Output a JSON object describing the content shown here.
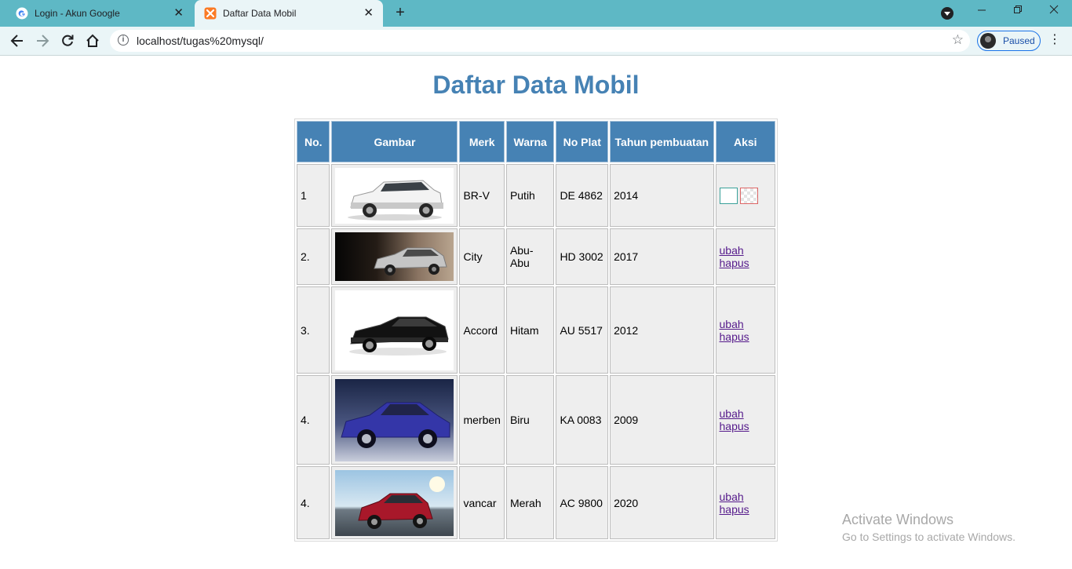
{
  "browser": {
    "tabs": [
      {
        "title": "Login - Akun Google",
        "active": false,
        "favicon": "google-icon"
      },
      {
        "title": "Daftar Data Mobil",
        "active": true,
        "favicon": "xampp-icon"
      }
    ],
    "close_glyph": "✕",
    "new_tab_glyph": "+",
    "address": "localhost/tugas%20mysql/",
    "profile_status": "Paused",
    "colors": {
      "tabstrip": "#5eb8c5",
      "toolbar": "#eaf5f7"
    }
  },
  "page": {
    "title": "Daftar Data Mobil",
    "columns": [
      "No.",
      "Gambar",
      "Merk",
      "Warna",
      "No Plat",
      "Tahun pembuatan",
      "Aksi"
    ],
    "rows": [
      {
        "no": "1",
        "merk": "BR-V",
        "warna": "Putih",
        "plat": "DE 4862",
        "tahun": "2014",
        "image": "white-suv",
        "aksi": "broken-images"
      },
      {
        "no": "2.",
        "merk": "City",
        "warna": "Abu-Abu",
        "plat": "HD 3002",
        "tahun": "2017",
        "image": "grey-sedan",
        "aksi": "links"
      },
      {
        "no": "3.",
        "merk": "Accord",
        "warna": "Hitam",
        "plat": "AU 5517",
        "tahun": "2012",
        "image": "black-sedan",
        "aksi": "links"
      },
      {
        "no": "4.",
        "merk": "merben",
        "warna": "Biru",
        "plat": "KA 0083",
        "tahun": "2009",
        "image": "blue-sedan",
        "aksi": "links"
      },
      {
        "no": "4.",
        "merk": "vancar",
        "warna": "Merah",
        "plat": "AC 9800",
        "tahun": "2020",
        "image": "red-crossover",
        "aksi": "links"
      }
    ],
    "edit_label": "ubah",
    "delete_label": "hapus",
    "colors": {
      "header_bg": "#4682b4",
      "title": "#4682b4",
      "cell_bg": "#eeeeee",
      "link": "#551a8b"
    }
  },
  "watermark": {
    "line1": "Activate Windows",
    "line2": "Go to Settings to activate Windows."
  }
}
